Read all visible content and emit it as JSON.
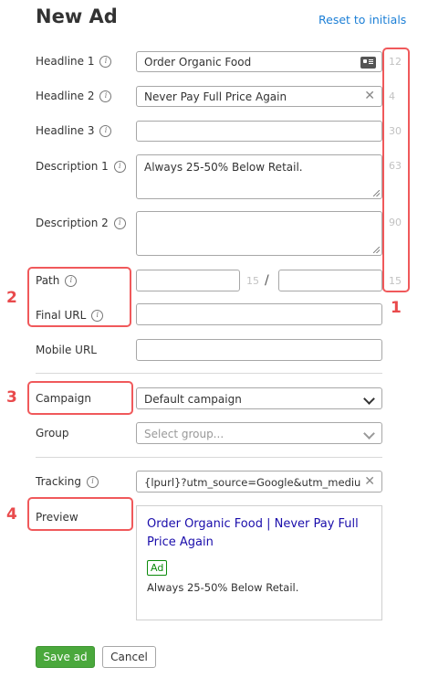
{
  "header": {
    "title": "New Ad",
    "reset_label": "Reset to initials"
  },
  "form": {
    "headline1": {
      "label": "Headline 1",
      "value": "Order Organic Food",
      "counter": "12"
    },
    "headline2": {
      "label": "Headline 2",
      "value": "Never Pay Full Price Again",
      "counter": "4"
    },
    "headline3": {
      "label": "Headline 3",
      "value": "",
      "counter": "30"
    },
    "description1": {
      "label": "Description 1",
      "value": "Always 25-50% Below Retail.",
      "counter": "63"
    },
    "description2": {
      "label": "Description 2",
      "value": "",
      "counter": "90"
    },
    "path": {
      "label": "Path",
      "counter1": "15",
      "separator": "/",
      "counter2": "15"
    },
    "final_url": {
      "label": "Final URL",
      "value": ""
    },
    "mobile_url": {
      "label": "Mobile URL",
      "value": ""
    },
    "campaign": {
      "label": "Campaign",
      "selected": "Default campaign"
    },
    "group": {
      "label": "Group",
      "placeholder": "Select group..."
    },
    "tracking": {
      "label": "Tracking",
      "value": "{lpurl}?utm_source=Google&utm_medium="
    }
  },
  "preview": {
    "label": "Preview",
    "title_line1": "Order Organic Food | Never Pay Full",
    "title_line2": "Price Again",
    "badge": "Ad",
    "description": "Always 25-50% Below Retail."
  },
  "buttons": {
    "save": "Save ad",
    "cancel": "Cancel"
  },
  "callouts": [
    "1",
    "2",
    "3",
    "4"
  ],
  "colors": {
    "accent_link": "#1c7fd6",
    "highlight": "#f0595b",
    "save_button": "#4aa83c",
    "ad_title": "#1a0dab"
  }
}
